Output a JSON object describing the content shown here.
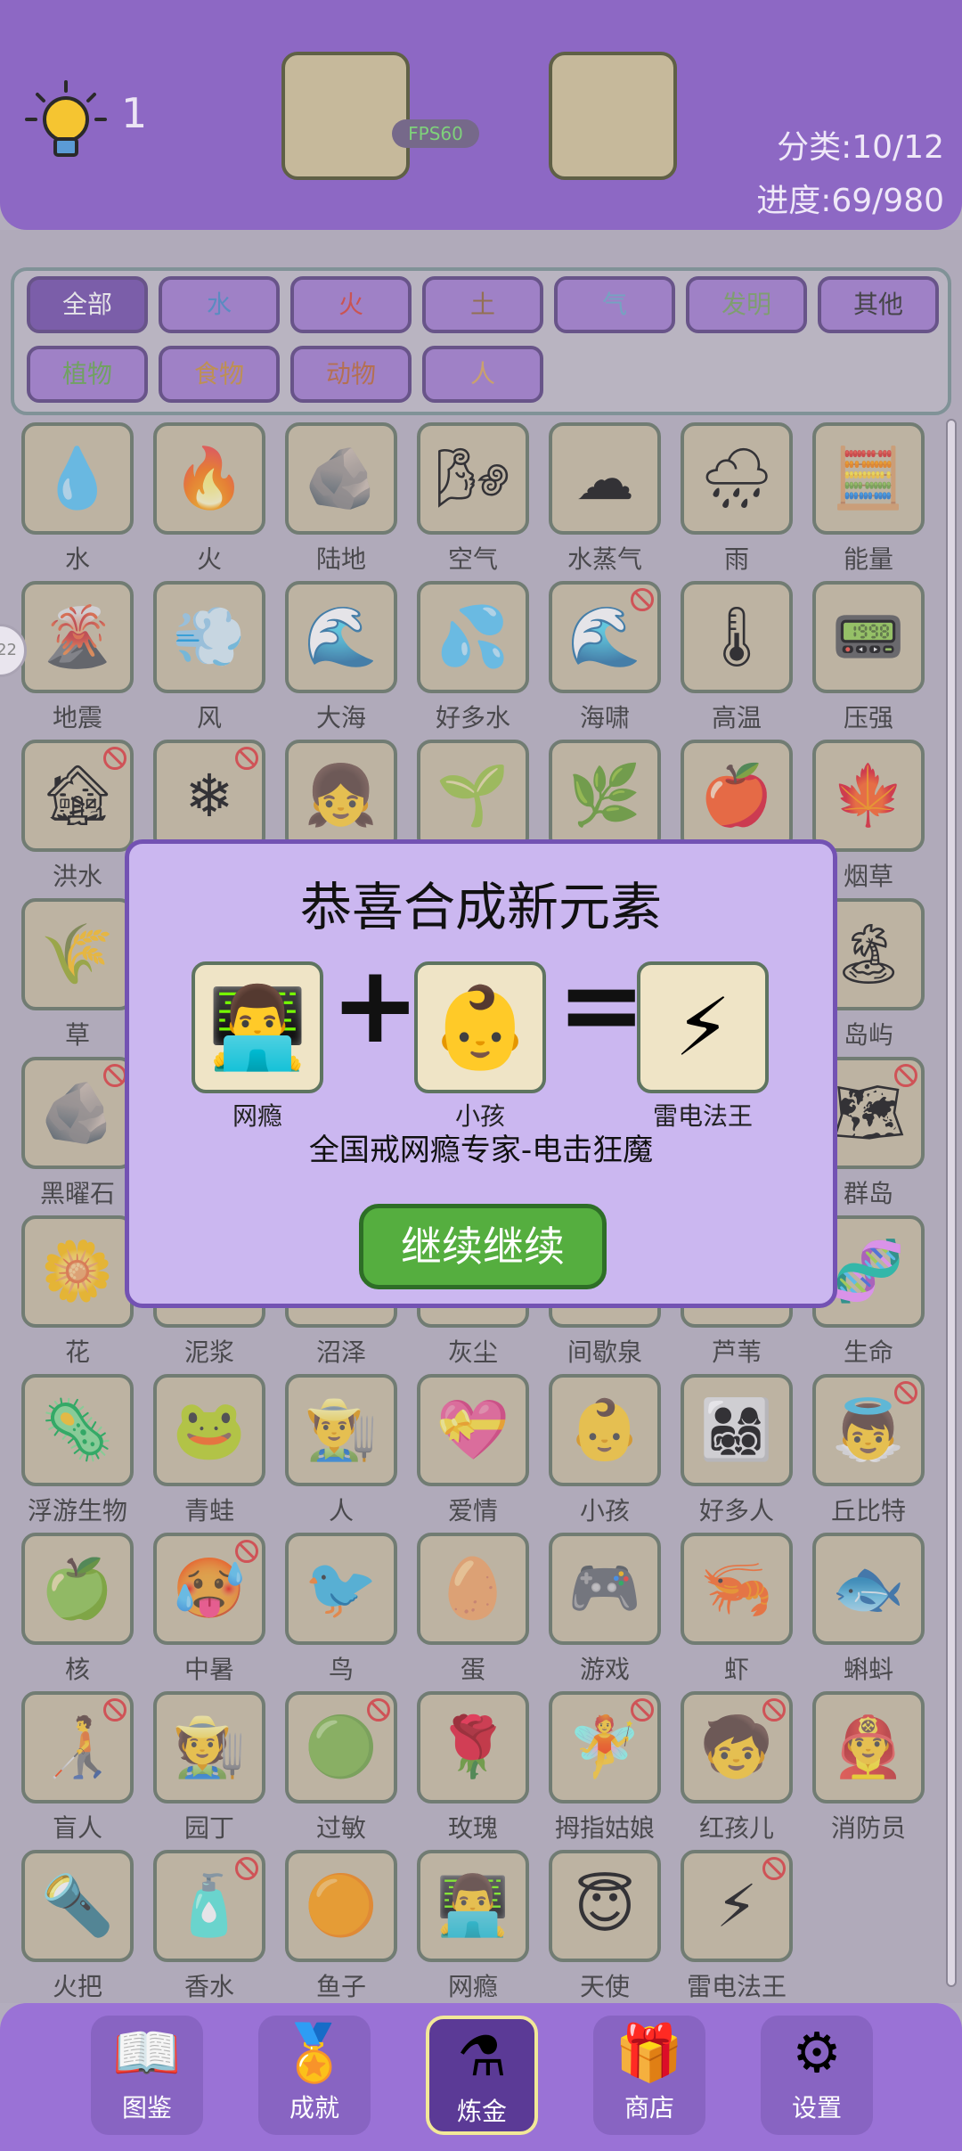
{
  "header": {
    "hint_count": "1",
    "fps": "FPS60",
    "category_stat": "分类:10/12",
    "progress_stat": "进度:69/980"
  },
  "filters": [
    {
      "label": "全部",
      "color": "#ffffff",
      "active": true
    },
    {
      "label": "水",
      "color": "#3a80c8"
    },
    {
      "label": "火",
      "color": "#d8322a"
    },
    {
      "label": "土",
      "color": "#8a5a2a"
    },
    {
      "label": "气",
      "color": "#5fa3c8"
    },
    {
      "label": "发明",
      "color": "#6e9a55"
    },
    {
      "label": "其他",
      "color": "#1a1a1a"
    },
    {
      "label": "植物",
      "color": "#5aa040"
    },
    {
      "label": "食物",
      "color": "#c8872a"
    },
    {
      "label": "动物",
      "color": "#b95a2a"
    },
    {
      "label": "人",
      "color": "#d8a050"
    }
  ],
  "elements": [
    {
      "name": "水",
      "icon": "💧",
      "disabled": false
    },
    {
      "name": "火",
      "icon": "🔥",
      "disabled": false
    },
    {
      "name": "陆地",
      "icon": "🪨",
      "disabled": false
    },
    {
      "name": "空气",
      "icon": "🌬",
      "disabled": false
    },
    {
      "name": "水蒸气",
      "icon": "☁",
      "disabled": false
    },
    {
      "name": "雨",
      "icon": "🌧",
      "disabled": false
    },
    {
      "name": "能量",
      "icon": "🧮",
      "disabled": false
    },
    {
      "name": "地震",
      "icon": "🌋",
      "disabled": false
    },
    {
      "name": "风",
      "icon": "💨",
      "disabled": false
    },
    {
      "name": "大海",
      "icon": "🌊",
      "disabled": false
    },
    {
      "name": "好多水",
      "icon": "💦",
      "disabled": false
    },
    {
      "name": "海啸",
      "icon": "🌊",
      "disabled": true
    },
    {
      "name": "高温",
      "icon": "🌡",
      "disabled": false
    },
    {
      "name": "压强",
      "icon": "📟",
      "disabled": false
    },
    {
      "name": "洪水",
      "icon": "🏚",
      "disabled": true
    },
    {
      "name": "",
      "icon": "❄",
      "disabled": true
    },
    {
      "name": "",
      "icon": "👧",
      "disabled": false
    },
    {
      "name": "",
      "icon": "🌱",
      "disabled": false
    },
    {
      "name": "",
      "icon": "🌿",
      "disabled": false
    },
    {
      "name": "",
      "icon": "🍎",
      "disabled": false
    },
    {
      "name": "烟草",
      "icon": "🍁",
      "disabled": false
    },
    {
      "name": "草",
      "icon": "🌾",
      "disabled": false
    },
    {
      "name": "",
      "icon": "",
      "disabled": false
    },
    {
      "name": "",
      "icon": "",
      "disabled": false
    },
    {
      "name": "",
      "icon": "",
      "disabled": false
    },
    {
      "name": "",
      "icon": "",
      "disabled": false
    },
    {
      "name": "",
      "icon": "",
      "disabled": false
    },
    {
      "name": "岛屿",
      "icon": "🏝",
      "disabled": false
    },
    {
      "name": "黑曜石",
      "icon": "🪨",
      "disabled": true
    },
    {
      "name": "",
      "icon": "",
      "disabled": false
    },
    {
      "name": "",
      "icon": "",
      "disabled": false
    },
    {
      "name": "",
      "icon": "",
      "disabled": false
    },
    {
      "name": "",
      "icon": "",
      "disabled": false
    },
    {
      "name": "",
      "icon": "",
      "disabled": false
    },
    {
      "name": "群岛",
      "icon": "🗺",
      "disabled": true
    },
    {
      "name": "花",
      "icon": "🌼",
      "disabled": false
    },
    {
      "name": "泥浆",
      "icon": "",
      "disabled": false
    },
    {
      "name": "沼泽",
      "icon": "",
      "disabled": false
    },
    {
      "name": "灰尘",
      "icon": "",
      "disabled": false
    },
    {
      "name": "间歇泉",
      "icon": "",
      "disabled": false
    },
    {
      "name": "芦苇",
      "icon": "",
      "disabled": false
    },
    {
      "name": "生命",
      "icon": "🧬",
      "disabled": false
    },
    {
      "name": "浮游生物",
      "icon": "🦠",
      "disabled": false
    },
    {
      "name": "青蛙",
      "icon": "🐸",
      "disabled": false
    },
    {
      "name": "人",
      "icon": "👨‍🌾",
      "disabled": false
    },
    {
      "name": "爱情",
      "icon": "💝",
      "disabled": false
    },
    {
      "name": "小孩",
      "icon": "👶",
      "disabled": false
    },
    {
      "name": "好多人",
      "icon": "👨‍👩‍👧‍👦",
      "disabled": false
    },
    {
      "name": "丘比特",
      "icon": "👼",
      "disabled": true
    },
    {
      "name": "核",
      "icon": "🍏",
      "disabled": false
    },
    {
      "name": "中暑",
      "icon": "🥵",
      "disabled": true
    },
    {
      "name": "鸟",
      "icon": "🐦",
      "disabled": false
    },
    {
      "name": "蛋",
      "icon": "🥚",
      "disabled": false
    },
    {
      "name": "游戏",
      "icon": "🎮",
      "disabled": false
    },
    {
      "name": "虾",
      "icon": "🦐",
      "disabled": false
    },
    {
      "name": "蝌蚪",
      "icon": "🐟",
      "disabled": false
    },
    {
      "name": "盲人",
      "icon": "🧑‍🦯",
      "disabled": true
    },
    {
      "name": "园丁",
      "icon": "🧑‍🌾",
      "disabled": false
    },
    {
      "name": "过敏",
      "icon": "🟢",
      "disabled": true
    },
    {
      "name": "玫瑰",
      "icon": "🌹",
      "disabled": false
    },
    {
      "name": "拇指姑娘",
      "icon": "🧚",
      "disabled": true
    },
    {
      "name": "红孩儿",
      "icon": "🧒",
      "disabled": true
    },
    {
      "name": "消防员",
      "icon": "👨‍🚒",
      "disabled": false
    },
    {
      "name": "火把",
      "icon": "🔦",
      "disabled": false
    },
    {
      "name": "香水",
      "icon": "🧴",
      "disabled": true
    },
    {
      "name": "鱼子",
      "icon": "🟠",
      "disabled": false
    },
    {
      "name": "网瘾",
      "icon": "👨‍💻",
      "disabled": false
    },
    {
      "name": "天使",
      "icon": "😇",
      "disabled": false
    },
    {
      "name": "雷电法王",
      "icon": "⚡",
      "disabled": true
    }
  ],
  "modal": {
    "title": "恭喜合成新元素",
    "left_name": "网瘾",
    "left_icon": "👨‍💻",
    "right_name": "小孩",
    "right_icon": "👶",
    "result_name": "雷电法王",
    "result_icon": "⚡",
    "plus": "+",
    "equals": "=",
    "description": "全国戒网瘾专家-电击狂魔",
    "continue_label": "继续继续"
  },
  "nav": [
    {
      "label": "图鉴",
      "icon": "📖"
    },
    {
      "label": "成就",
      "icon": "🏅"
    },
    {
      "label": "炼金",
      "icon": "⚗",
      "active": true
    },
    {
      "label": "商店",
      "icon": "🎁"
    },
    {
      "label": "设置",
      "icon": "⚙"
    }
  ],
  "side_handle": "22"
}
